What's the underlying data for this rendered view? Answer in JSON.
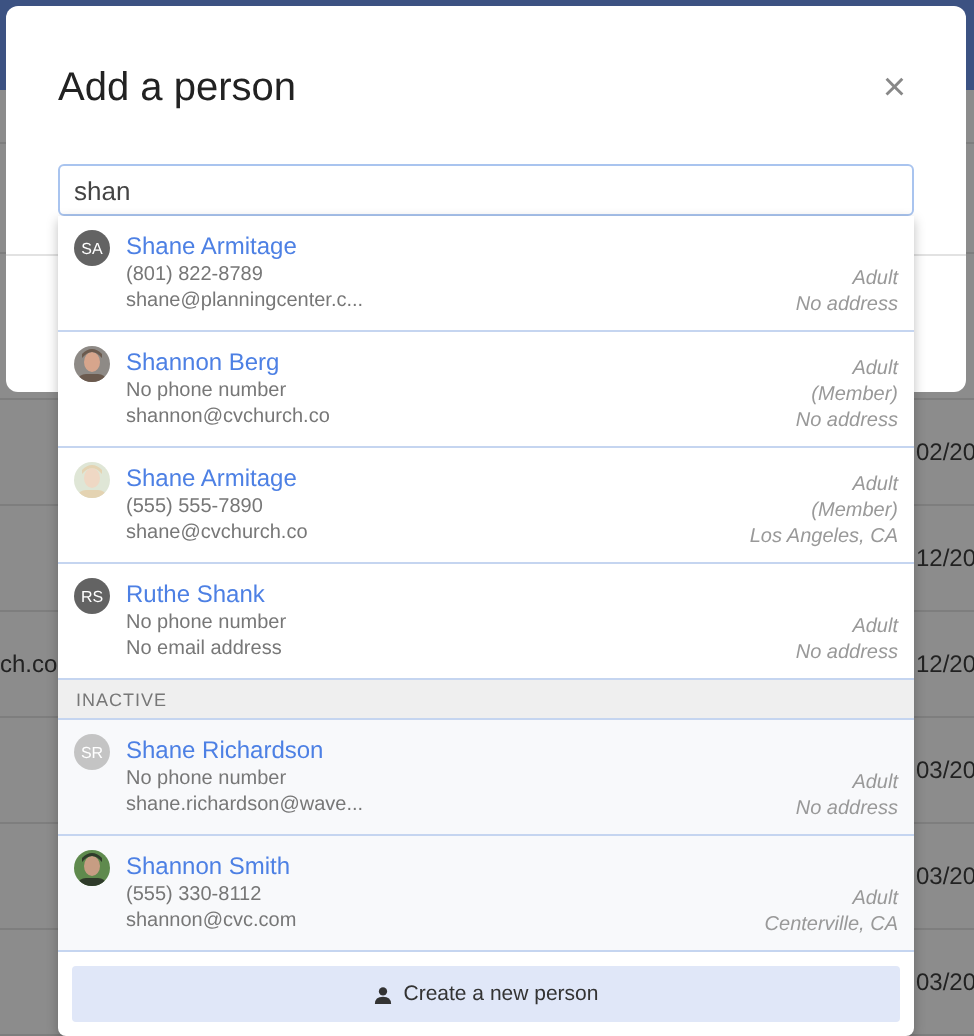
{
  "background_rows": [
    {
      "right": "02/20"
    },
    {
      "right": "12/20"
    },
    {
      "left": "ch.co",
      "right": "12/20"
    },
    {
      "right": "03/20"
    },
    {
      "right": "03/20"
    },
    {
      "right": "03/20"
    }
  ],
  "dialog": {
    "title": "Add a person",
    "close": "×",
    "search": {
      "value": "shan"
    },
    "results": [
      {
        "name": "Shane Armitage",
        "avatar": {
          "kind": "initials",
          "initials": "SA"
        },
        "phone": "(801) 822-8789",
        "email": "shane@planningcenter.c...",
        "details": [
          "Adult",
          "No address"
        ]
      },
      {
        "name": "Shannon Berg",
        "avatar": {
          "kind": "picture"
        },
        "phone": "No phone number",
        "email": "shannon@cvchurch.co",
        "details": [
          "Adult",
          "(Member)",
          "No address"
        ]
      },
      {
        "name": "Shane Armitage",
        "avatar": {
          "kind": "picture"
        },
        "phone": "(555) 555-7890",
        "email": "shane@cvchurch.co",
        "details": [
          "Adult",
          "(Member)",
          "Los Angeles, CA"
        ]
      },
      {
        "name": "Ruthe Shank",
        "avatar": {
          "kind": "initials",
          "initials": "RS"
        },
        "phone": "No phone number",
        "email": "No email address",
        "details": [
          "Adult",
          "No address"
        ]
      }
    ],
    "inactive": {
      "heading": "INACTIVE",
      "results": [
        {
          "name": "Shane Richardson",
          "avatar": {
            "kind": "initials",
            "initials": "SR"
          },
          "phone": "No phone number",
          "email": "shane.richardson@wave...",
          "details": [
            "Adult",
            "No address"
          ]
        },
        {
          "name": "Shannon Smith",
          "avatar": {
            "kind": "picture"
          },
          "phone": "(555) 330-8112",
          "email": "shannon@cvc.com",
          "details": [
            "Adult",
            "Centerville, CA"
          ]
        }
      ]
    },
    "create_button": "Create a new person"
  }
}
